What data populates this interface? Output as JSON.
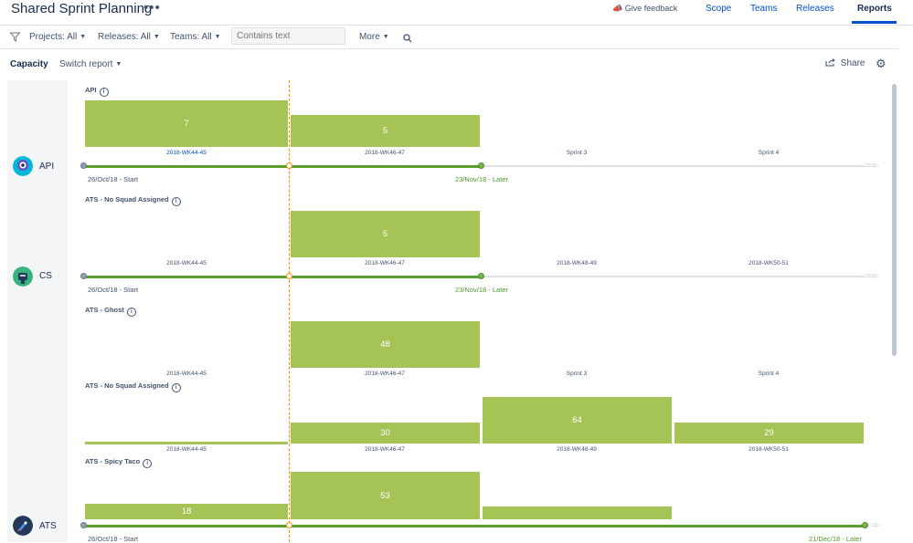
{
  "header": {
    "title": "Shared Sprint Planning",
    "more_label": "•••",
    "feedback_label": "Give feedback",
    "tabs": [
      "Scope",
      "Teams",
      "Releases",
      "Reports"
    ],
    "active_tab": "Reports"
  },
  "filters": {
    "projects": "Projects: All",
    "releases": "Releases: All",
    "teams": "Teams: All",
    "search_placeholder": "Contains text",
    "more": "More"
  },
  "report": {
    "title": "Capacity",
    "switch_label": "Switch report",
    "share_label": "Share"
  },
  "teams": [
    "API",
    "CS",
    "ATS"
  ],
  "sections": [
    {
      "title": "API",
      "bars": [
        7,
        5
      ],
      "axis": [
        "2018-WK44-45",
        "2018-WK46-47",
        "Sprint 3",
        "Sprint 4"
      ]
    },
    {
      "title": "ATS - No Squad Assigned",
      "bars": [
        5
      ],
      "axis": [
        "2018-WK44-45",
        "2018-WK46-47",
        "2018-WK48-49",
        "2018-WK50-51"
      ]
    },
    {
      "title": "ATS - Ghost",
      "bars": [
        48
      ],
      "axis": [
        "2018-WK44-45",
        "2018-WK46-47",
        "Sprint 3",
        "Sprint 4"
      ]
    },
    {
      "title": "ATS - No Squad Assigned",
      "bars": [
        30,
        64,
        29
      ],
      "axis": [
        "2018-WK44-45",
        "2018-WK46-47",
        "2018-WK48-49",
        "2018-WK50-51"
      ]
    },
    {
      "title": "ATS - Spicy Taco",
      "bars": [
        18,
        53
      ]
    }
  ],
  "timelines": [
    {
      "start": "26/Oct/18 - Start",
      "end": "23/Nov/18 - Later"
    },
    {
      "start": "26/Oct/18 - Start",
      "end": "23/Nov/18 - Later"
    },
    {
      "start": "26/Oct/18 - Start",
      "end": "21/Dec/18 - Later"
    }
  ],
  "colors": {
    "bar": "#a6c456",
    "link": "#0052cc",
    "today_line": "#ff8b00",
    "range": "#5aa02c"
  }
}
